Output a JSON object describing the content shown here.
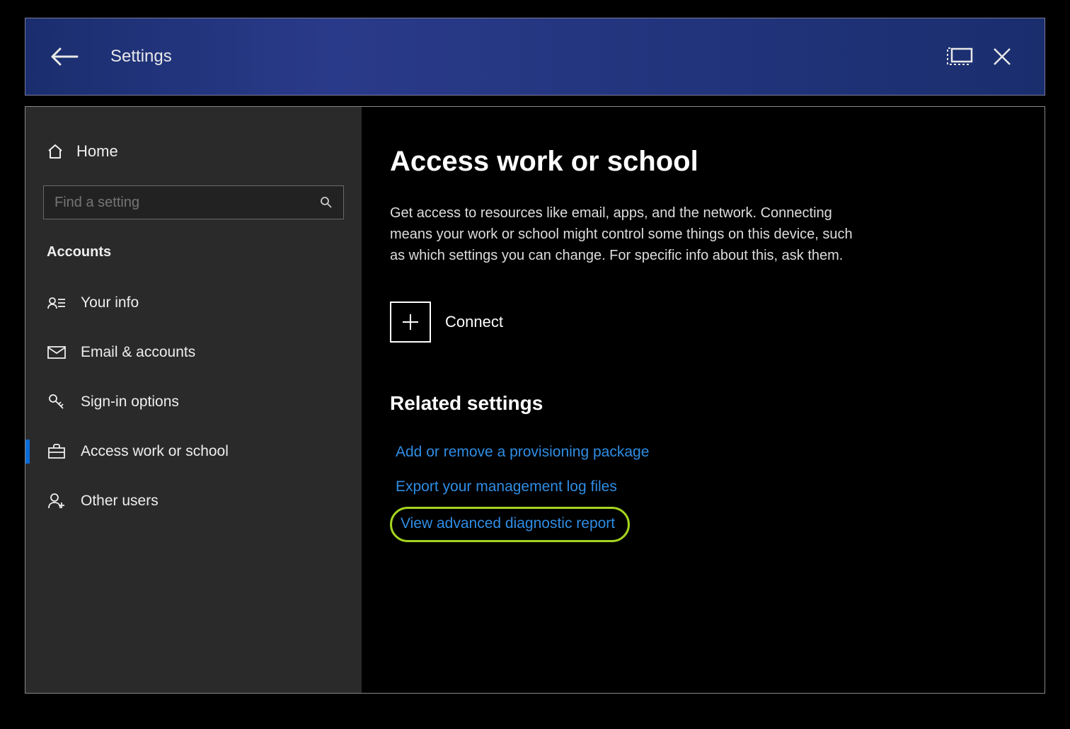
{
  "titlebar": {
    "title": "Settings"
  },
  "sidebar": {
    "home": "Home",
    "search_placeholder": "Find a setting",
    "section": "Accounts",
    "items": [
      {
        "label": "Your info"
      },
      {
        "label": "Email & accounts"
      },
      {
        "label": "Sign-in options"
      },
      {
        "label": "Access work or school"
      },
      {
        "label": "Other users"
      }
    ]
  },
  "main": {
    "title": "Access work or school",
    "description": "Get access to resources like email, apps, and the network. Connecting means your work or school might control some things on this device, such as which settings you can change. For specific info about this, ask them.",
    "connect": "Connect",
    "related_title": "Related settings",
    "links": [
      "Add or remove a provisioning package",
      "Export your management log files",
      "View advanced diagnostic report"
    ]
  }
}
